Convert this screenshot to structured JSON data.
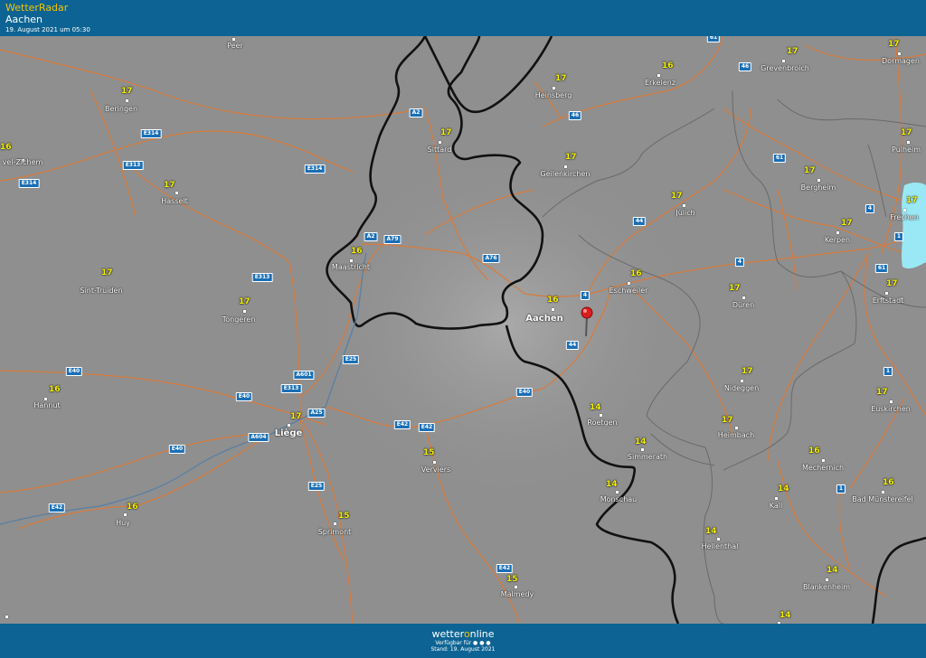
{
  "header": {
    "brand": "WetterRadar",
    "location": "Aachen",
    "date": "19. August 2021 um 05:30"
  },
  "footer": {
    "logo_pre": "wetter",
    "logo_o": "o",
    "logo_post": "nline",
    "available": "Verfügbar für ● ● ●",
    "stand": "Stand: 19. August 2021"
  },
  "colors": {
    "header": "#0d6494",
    "map_bg": "#8f8f8f",
    "temperature": "#f7f300",
    "road_sign": "#1a6fb5",
    "road_line": "#d87b3c",
    "border_line": "#111111",
    "rain_cell": "#9ae8f5",
    "pin": "#d81e1e"
  },
  "places": [
    {
      "id": "peer",
      "name": "Peer",
      "temp": ""
    },
    {
      "id": "beringen",
      "name": "Beringen",
      "temp": "17"
    },
    {
      "id": "zichem",
      "name": "vel-Zichem",
      "temp": "16"
    },
    {
      "id": "hasselt",
      "name": "Hasselt",
      "temp": "17"
    },
    {
      "id": "sint-truiden",
      "name": "Sint-Truiden",
      "temp": "17"
    },
    {
      "id": "tongeren",
      "name": "Tongeren",
      "temp": "17"
    },
    {
      "id": "maastricht",
      "name": "Maastricht",
      "temp": "16"
    },
    {
      "id": "hannut",
      "name": "Hannut",
      "temp": "16"
    },
    {
      "id": "liege",
      "name": "Liège",
      "temp": "17"
    },
    {
      "id": "huy",
      "name": "Huy",
      "temp": "16"
    },
    {
      "id": "sprimont",
      "name": "Sprimont",
      "temp": "15"
    },
    {
      "id": "verviers",
      "name": "Verviers",
      "temp": "15"
    },
    {
      "id": "malmedy",
      "name": "Malmedy",
      "temp": "15"
    },
    {
      "id": "sittard",
      "name": "Sittard",
      "temp": "17"
    },
    {
      "id": "heinsberg",
      "name": "Heinsberg",
      "temp": "17"
    },
    {
      "id": "geilenkirchen",
      "name": "Geilenkirchen",
      "temp": "17"
    },
    {
      "id": "erkelenz",
      "name": "Erkelenz",
      "temp": "16"
    },
    {
      "id": "juelich",
      "name": "Jülich",
      "temp": "17"
    },
    {
      "id": "aachen",
      "name": "Aachen",
      "temp": "16"
    },
    {
      "id": "eschweiler",
      "name": "Eschweiler",
      "temp": "16"
    },
    {
      "id": "roetgen",
      "name": "Roetgen",
      "temp": "14"
    },
    {
      "id": "simmerath",
      "name": "Simmerath",
      "temp": "14"
    },
    {
      "id": "monschau",
      "name": "Monschau",
      "temp": "14"
    },
    {
      "id": "dueren",
      "name": "Düren",
      "temp": "17"
    },
    {
      "id": "nideggen",
      "name": "Nideggen",
      "temp": "17"
    },
    {
      "id": "heimbach",
      "name": "Heimbach",
      "temp": "17"
    },
    {
      "id": "hellenthal",
      "name": "Hellenthal",
      "temp": "14"
    },
    {
      "id": "grevenbroich",
      "name": "Grevenbroich",
      "temp": "17"
    },
    {
      "id": "dormagen",
      "name": "Dormagen",
      "temp": "17"
    },
    {
      "id": "pulheim",
      "name": "Pulheim",
      "temp": "17"
    },
    {
      "id": "bergheim",
      "name": "Bergheim",
      "temp": "17"
    },
    {
      "id": "frechen",
      "name": "Frechen",
      "temp": "17"
    },
    {
      "id": "kerpen",
      "name": "Kerpen",
      "temp": "17"
    },
    {
      "id": "erftstadt",
      "name": "Erftstadt",
      "temp": "17"
    },
    {
      "id": "euskirchen",
      "name": "Euskirchen",
      "temp": "17"
    },
    {
      "id": "mechernich",
      "name": "Mechernich",
      "temp": "16"
    },
    {
      "id": "kall",
      "name": "Kall",
      "temp": "14"
    },
    {
      "id": "bad-muenstereifel",
      "name": "Bad Münstereifel",
      "temp": "16"
    },
    {
      "id": "blankenheim",
      "name": "Blankenheim",
      "temp": "14"
    },
    {
      "id": "edge-bottom",
      "name": "",
      "temp": "14"
    }
  ],
  "roads": [
    "61",
    "46",
    "46",
    "A2",
    "E314",
    "E313",
    "E314",
    "E314",
    "A79",
    "A2",
    "A76",
    "44",
    "61",
    "4",
    "4",
    "61",
    "1",
    "1",
    "E313",
    "4",
    "44",
    "E40",
    "A601",
    "E25",
    "E40",
    "E313",
    "A25",
    "E40",
    "E42",
    "E42",
    "A604",
    "E40",
    "E42",
    "E25",
    "E42",
    "1"
  ]
}
